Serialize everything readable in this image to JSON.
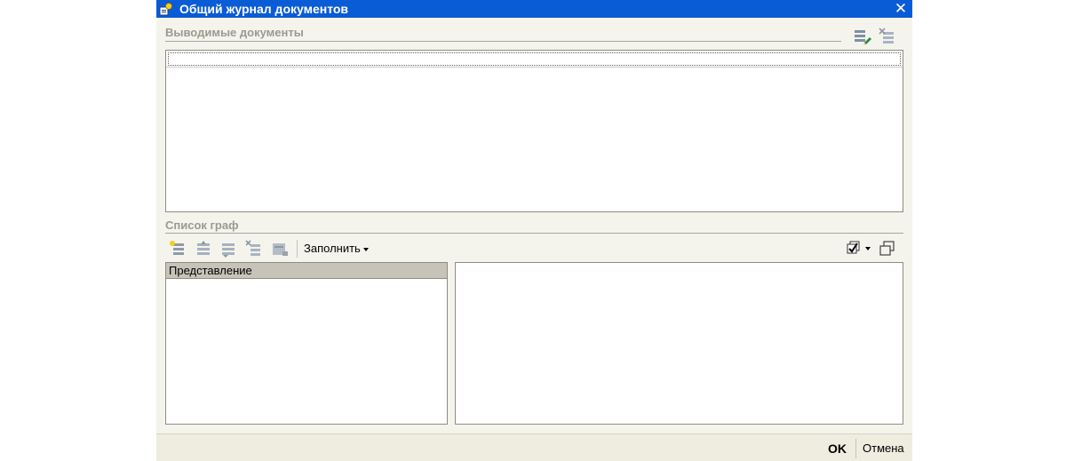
{
  "window": {
    "title": "Общий журнал документов"
  },
  "documents_section": {
    "label": "Выводимые документы"
  },
  "columns_section": {
    "label": "Список граф",
    "fill_label": "Заполнить",
    "table_header": "Представление"
  },
  "footer": {
    "ok_label": "OK",
    "cancel_label": "Отмена"
  },
  "colors": {
    "titlebar": "#0a5bd6",
    "window_bg": "#f5f4ec",
    "section_label": "#9b9a8e",
    "header_bg": "#c7c3b8"
  }
}
